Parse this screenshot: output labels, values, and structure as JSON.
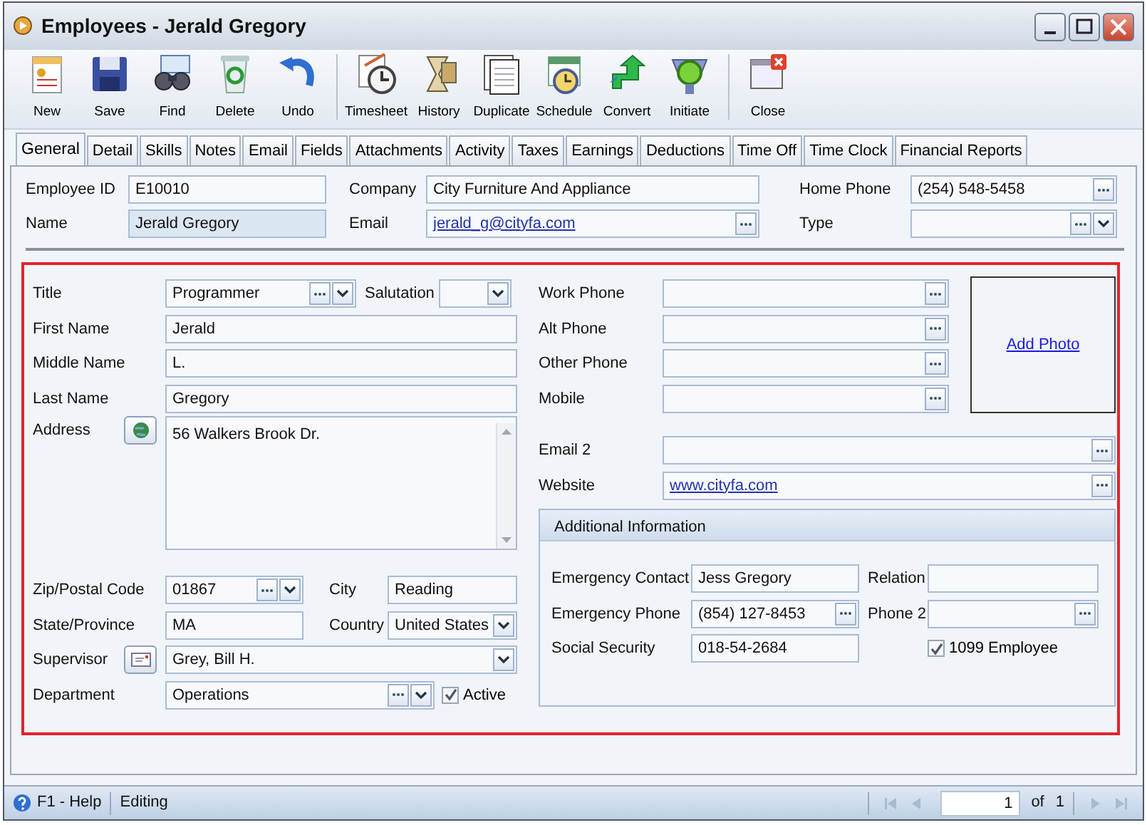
{
  "window": {
    "title": "Employees - Jerald Gregory"
  },
  "toolbar": [
    [
      {
        "label": "New"
      },
      {
        "label": "Save"
      },
      {
        "label": "Find"
      },
      {
        "label": "Delete"
      },
      {
        "label": "Undo"
      }
    ],
    [
      {
        "label": "Timesheet"
      },
      {
        "label": "History"
      },
      {
        "label": "Duplicate"
      },
      {
        "label": "Schedule"
      },
      {
        "label": "Convert"
      },
      {
        "label": "Initiate"
      }
    ],
    [
      {
        "label": "Close"
      }
    ]
  ],
  "tabs": [
    {
      "label": "General",
      "selected": true
    },
    {
      "label": "Detail",
      "selected": false
    },
    {
      "label": "Skills",
      "selected": false
    },
    {
      "label": "Notes",
      "selected": false
    },
    {
      "label": "Email",
      "selected": false
    },
    {
      "label": "Fields",
      "selected": false
    },
    {
      "label": "Attachments",
      "selected": false
    },
    {
      "label": "Activity",
      "selected": false
    },
    {
      "label": "Taxes",
      "selected": false
    },
    {
      "label": "Earnings",
      "selected": false
    },
    {
      "label": "Deductions",
      "selected": false
    },
    {
      "label": "Time Off",
      "selected": false
    },
    {
      "label": "Time Clock",
      "selected": false
    },
    {
      "label": "Financial Reports",
      "selected": false
    }
  ],
  "header": [
    {
      "label": "Employee ID",
      "value": "E10010",
      "kind": "text"
    },
    {
      "label": "Company",
      "value": "City Furniture And Appliance",
      "kind": "text"
    },
    {
      "label": "Home Phone",
      "value": "(254) 548-5458",
      "kind": "lookup"
    },
    {
      "label": "Name",
      "value": "Jerald Gregory",
      "kind": "readonly"
    },
    {
      "label": "Email",
      "value": "jerald_g@cityfa.com",
      "kind": "link"
    },
    {
      "label": "Type",
      "kind": "combo"
    }
  ],
  "personal": {
    "title": {
      "label": "Title",
      "value": "Programmer",
      "kind": "combo"
    },
    "salutation": {
      "label": "Salutation",
      "kind": "dropdown"
    },
    "first_name": {
      "label": "First Name",
      "value": "Jerald",
      "kind": "text"
    },
    "middle_name": {
      "label": "Middle Name",
      "value": "L.",
      "kind": "text"
    },
    "last_name": {
      "label": "Last Name",
      "value": "Gregory",
      "kind": "text"
    },
    "address": {
      "label": "Address",
      "value": "56 Walkers Brook Dr.",
      "kind": "memo"
    },
    "zip": {
      "label": "Zip/Postal Code",
      "value": "01867",
      "kind": "combo"
    },
    "city": {
      "label": "City",
      "value": "Reading",
      "kind": "text"
    },
    "state": {
      "label": "State/Province",
      "value": "MA",
      "kind": "text"
    },
    "country": {
      "label": "Country",
      "value": "United States",
      "kind": "dropdown"
    },
    "supervisor": {
      "label": "Supervisor",
      "value": "Grey, Bill H.",
      "kind": "dropdown"
    },
    "department": {
      "label": "Department",
      "value": "Operations",
      "kind": "combo"
    },
    "active": {
      "label": "Active",
      "checked": true
    }
  },
  "contact": [
    {
      "label": "Work Phone",
      "kind": "lookup"
    },
    {
      "label": "Alt Phone",
      "kind": "lookup"
    },
    {
      "label": "Other Phone",
      "kind": "lookup"
    },
    {
      "label": "Mobile",
      "kind": "lookup"
    }
  ],
  "photo": {
    "link": "Add Photo"
  },
  "online": [
    {
      "label": "Email 2",
      "kind": "lookup"
    },
    {
      "label": "Website",
      "value": "www.cityfa.com",
      "kind": "link"
    }
  ],
  "additional": {
    "title": "Additional Information",
    "emergency_contact": {
      "label": "Emergency Contact",
      "value": "Jess Gregory",
      "kind": "text"
    },
    "relation": {
      "label": "Relation",
      "kind": "text"
    },
    "emergency_phone": {
      "label": "Emergency Phone",
      "value": "(854) 127-8453",
      "kind": "lookup"
    },
    "phone_2": {
      "label": "Phone 2",
      "kind": "lookup"
    },
    "social_security": {
      "label": "Social Security",
      "value": "018-54-2684",
      "kind": "text"
    },
    "employee_1099": {
      "label": "1099 Employee",
      "checked": true
    }
  },
  "status_bar": {
    "help": "F1 - Help",
    "mode": "Editing",
    "page": "1",
    "of": "of",
    "total": "1"
  }
}
